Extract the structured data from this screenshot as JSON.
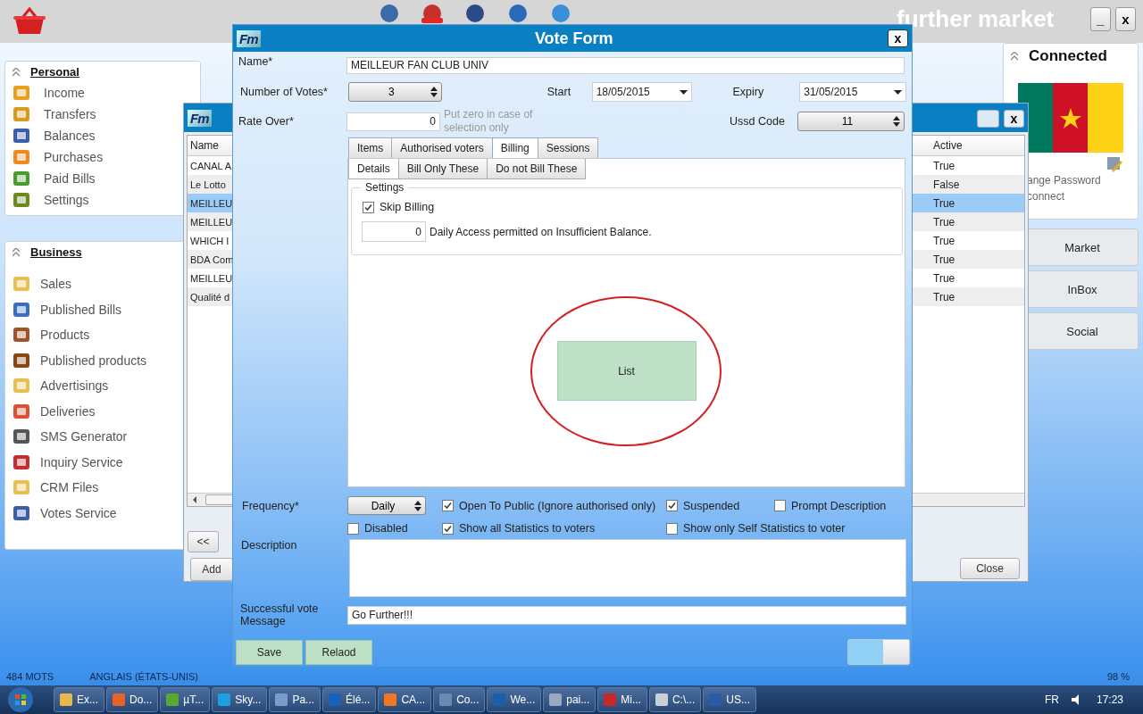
{
  "top_bar": {
    "brand": "further market",
    "window_buttons": [
      "_",
      "x"
    ]
  },
  "personal": {
    "title": "Personal",
    "items": [
      {
        "label": "Income"
      },
      {
        "label": "Transfers"
      },
      {
        "label": "Balances"
      },
      {
        "label": "Purchases"
      },
      {
        "label": "Paid Bills"
      },
      {
        "label": "Settings"
      }
    ]
  },
  "business": {
    "title": "Business",
    "items": [
      {
        "label": "Sales"
      },
      {
        "label": "Published Bills"
      },
      {
        "label": "Products"
      },
      {
        "label": "Published products"
      },
      {
        "label": "Advertisings"
      },
      {
        "label": "Deliveries"
      },
      {
        "label": "SMS Generator"
      },
      {
        "label": "Inquiry Service"
      },
      {
        "label": "CRM Files"
      },
      {
        "label": "Votes Service"
      }
    ]
  },
  "connected": {
    "title": "Connected",
    "links": [
      "ange Password",
      "connect"
    ],
    "buttons": [
      "Market",
      "InBox",
      "Social"
    ]
  },
  "list_window": {
    "logo": "Fm",
    "close": "x",
    "columns": [
      "Name",
      "Active"
    ],
    "rows": [
      {
        "name": "CANAL A",
        "active": "True",
        "selected": false
      },
      {
        "name": "Le Lotto",
        "active": "False",
        "selected": false
      },
      {
        "name": "MEILLEU",
        "active": "True",
        "selected": true
      },
      {
        "name": "MEILLEU",
        "active": "True",
        "selected": false
      },
      {
        "name": "WHICH I",
        "active": "True",
        "selected": false
      },
      {
        "name": "BDA Com",
        "active": "True",
        "selected": false
      },
      {
        "name": "MEILLEU",
        "active": "True",
        "selected": false
      },
      {
        "name": "Qualité d",
        "active": "True",
        "selected": false
      }
    ],
    "buttons": [
      "<<",
      "Add",
      "Close"
    ]
  },
  "vote_form": {
    "logo": "Fm",
    "title": "Vote Form",
    "close": "x",
    "name": {
      "label": "Name*",
      "value": "MEILLEUR FAN CLUB UNIV"
    },
    "votes": {
      "label": "Number of Votes*",
      "value": "3"
    },
    "start": {
      "label": "Start",
      "value": "18/05/2015"
    },
    "expiry": {
      "label": "Expiry",
      "value": "31/05/2015"
    },
    "rate": {
      "label": "Rate Over*",
      "value": "0",
      "hint": "Put zero in case of selection only"
    },
    "ussd": {
      "label": "Ussd Code",
      "value": "11"
    },
    "tabs": [
      {
        "label": "Items",
        "selected": false
      },
      {
        "label": "Authorised voters",
        "selected": false
      },
      {
        "label": "Billing",
        "selected": true
      },
      {
        "label": "Sessions",
        "selected": false
      }
    ],
    "subtabs": [
      {
        "label": "Details",
        "selected": true
      },
      {
        "label": "Bill Only These",
        "selected": false
      },
      {
        "label": "Do not Bill These",
        "selected": false
      }
    ],
    "settings": {
      "title": "Settings",
      "skip_billing": {
        "label": "Skip Billing",
        "checked": true
      },
      "daily_access": {
        "value": "0",
        "label": "Daily Access permitted on Insufficient Balance."
      }
    },
    "list_button": "List",
    "frequency": {
      "label": "Frequency*",
      "value": "Daily"
    },
    "options": [
      {
        "label": "Open To Public (Ignore authorised only)",
        "checked": true
      },
      {
        "label": "Suspended",
        "checked": true
      },
      {
        "label": "Prompt Description",
        "checked": false
      },
      {
        "label": "Disabled",
        "checked": false
      },
      {
        "label": "Show all Statistics to voters",
        "checked": true
      },
      {
        "label": "Show only Self Statistics to voter",
        "checked": false
      }
    ],
    "description": {
      "label": "Description"
    },
    "message": {
      "label": "Successful vote Message",
      "value": "Go Further!!!"
    },
    "buttons": [
      "Save",
      "Relaod"
    ],
    "toggle": {
      "on": true
    }
  },
  "word_status": [
    "484 MOTS",
    "ANGLAIS (ÉTATS-UNIS)",
    "98 %"
  ],
  "taskbar": {
    "items": [
      {
        "label": "Ex...",
        "color": "#e8b84a"
      },
      {
        "label": "Do...",
        "color": "#e8622a"
      },
      {
        "label": "µT...",
        "color": "#5aa832"
      },
      {
        "label": "Sky...",
        "color": "#1ea0e0"
      },
      {
        "label": "Pa...",
        "color": "#7a9cc8"
      },
      {
        "label": "Élé...",
        "color": "#1a62b8"
      },
      {
        "label": "CA...",
        "color": "#f07820"
      },
      {
        "label": "Co...",
        "color": "#6a8ab0"
      },
      {
        "label": "We...",
        "color": "#1b5fa8"
      },
      {
        "label": "pai...",
        "color": "#9aa8c0"
      },
      {
        "label": "Mi...",
        "color": "#c82828"
      },
      {
        "label": "C:\\...",
        "color": "#c8d0d8"
      },
      {
        "label": "US...",
        "color": "#2a5aa8"
      }
    ],
    "language": "FR",
    "clock": "17:23"
  }
}
